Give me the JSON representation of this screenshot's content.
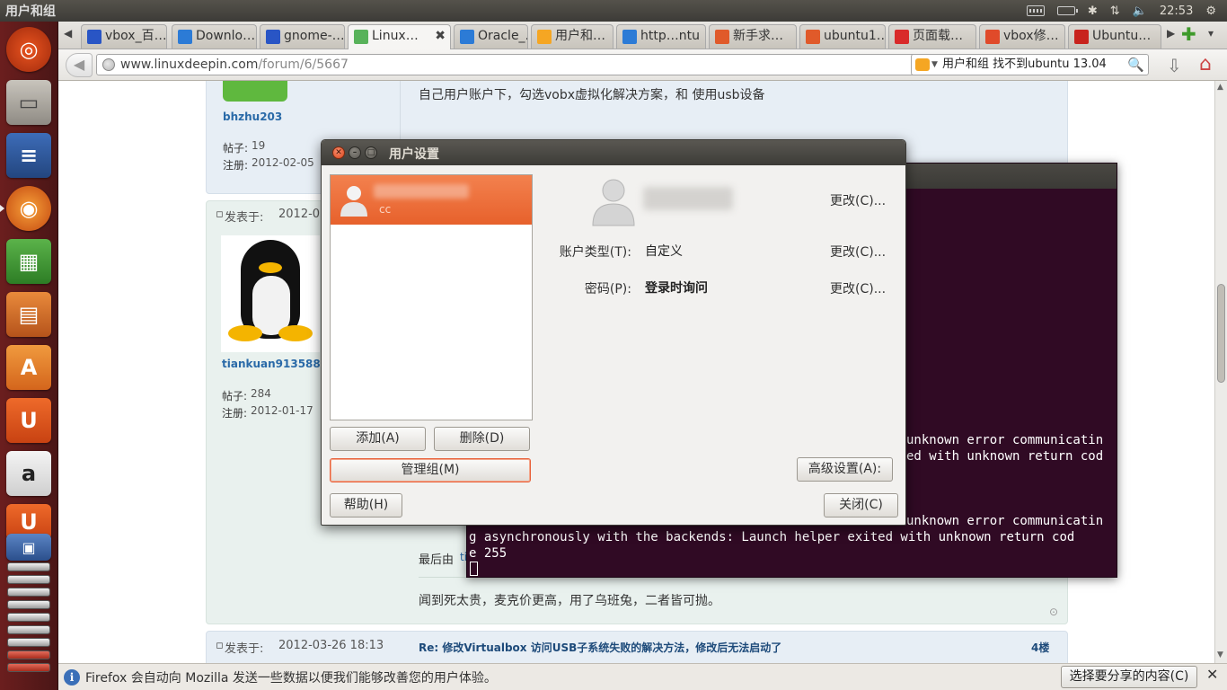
{
  "panel": {
    "title": "用户和组",
    "clock": "22:53"
  },
  "browser": {
    "tabs": [
      {
        "label": "vbox_百…",
        "color": "#2955c5"
      },
      {
        "label": "Downlo…",
        "color": "#2c7bd6"
      },
      {
        "label": "gnome-…",
        "color": "#2955c5"
      },
      {
        "label": "Linux…",
        "color": "#58b25a",
        "active": true
      },
      {
        "label": "Oracle_…",
        "color": "#2c7bd6"
      },
      {
        "label": "用户和…",
        "color": "#f5a623"
      },
      {
        "label": "http…ntu",
        "color": "#2c7bd6"
      },
      {
        "label": "新手求…",
        "color": "#e05a2a"
      },
      {
        "label": "ubuntu1…",
        "color": "#e05a2a"
      },
      {
        "label": "页面载…",
        "color": "#d92a2a"
      },
      {
        "label": "vbox修…",
        "color": "#e04a2a"
      },
      {
        "label": "Ubuntu…",
        "color": "#c8231d"
      }
    ],
    "url_host": "www.linuxdeepin.com",
    "url_path": "/forum/6/5667",
    "search_text": "用户和组 找不到ubuntu 13.04"
  },
  "forum": {
    "top_text": "自己用户账户下，勾选vobx虚拟化解决方案，和 使用usb设备",
    "user1": {
      "name": "bhzhu203",
      "posts_label": "帖子:",
      "posts": "19",
      "reg_label": "注册:",
      "reg": "2012-02-05"
    },
    "post2": {
      "posted_label": "发表于:",
      "posted_partial": "2012-03"
    },
    "user2": {
      "name": "tiankuan913588",
      "posts_label": "帖子:",
      "posts": "284",
      "reg_label": "注册:",
      "reg": "2012-01-17"
    },
    "edited_by": "最后由",
    "edited_user_partial": "tia",
    "signature": "闻到死太贵，麦克价更高，用了乌班兔，二者皆可抛。",
    "post3": {
      "posted_label": "发表于:",
      "posted": "2012-03-26 18:13",
      "title": "Re: 修改Virtualbox 访问USB子系统失败的解决方法，修改后无法启动了",
      "floor": "4楼"
    }
  },
  "notification": {
    "text": "Firefox 会自动向 Mozilla 发送一些数据以便我们能够改善您的用户体验。",
    "share_button": "选择要分享的内容(C)"
  },
  "terminal": {
    "lines": [
      "unknown error communicatin",
      "ed with unknown return cod",
      "unknown error communicatin",
      "g asynchronously with the backends: Launch helper exited with unknown return cod",
      "e 255"
    ]
  },
  "dialog": {
    "title": "用户设置",
    "selected_user_sub": "cc",
    "add_button": "添加(A)",
    "delete_button": "删除(D)",
    "manage_groups_button": "管理组(M)",
    "help_button": "帮助(H)",
    "change_label": "更改(C)...",
    "account_type_label": "账户类型(T):",
    "account_type_value": "自定义",
    "password_label": "密码(P):",
    "password_value": "登录时询问",
    "advanced_button": "高级设置(A):",
    "close_button": "关闭(C)"
  }
}
